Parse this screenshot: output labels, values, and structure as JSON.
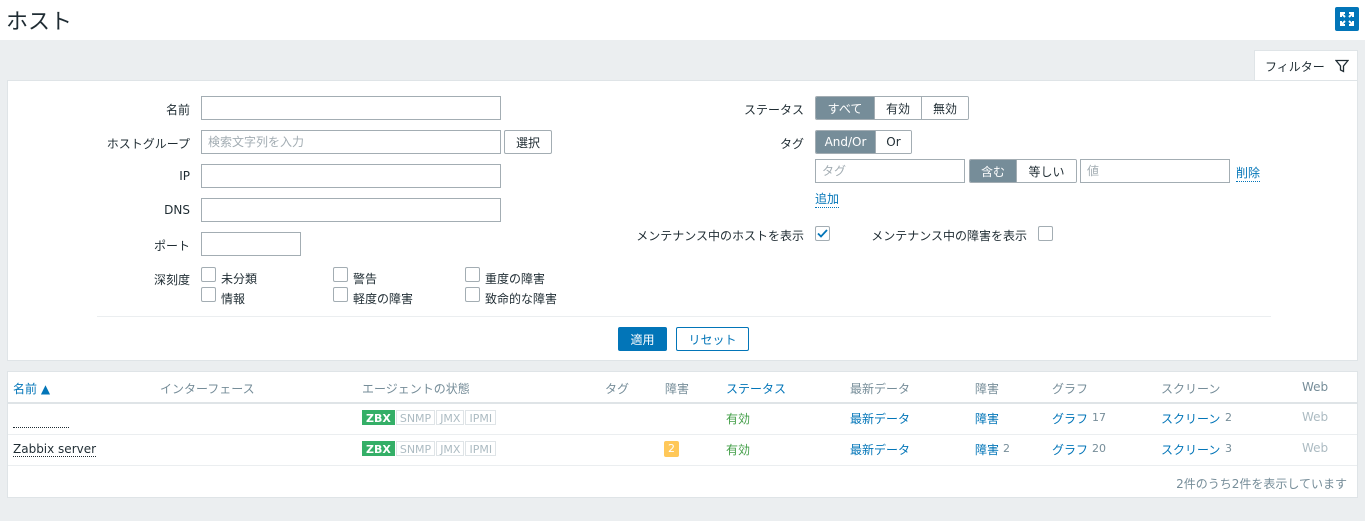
{
  "page": {
    "title": "ホスト"
  },
  "filter_tab": {
    "label": "フィルター"
  },
  "filter": {
    "name_label": "名前",
    "name_value": "",
    "hostgroup_label": "ホストグループ",
    "hostgroup_placeholder": "検索文字列を入力",
    "hostgroup_select": "選択",
    "ip_label": "IP",
    "ip_value": "",
    "dns_label": "DNS",
    "dns_value": "",
    "port_label": "ポート",
    "port_value": "",
    "severity_label": "深刻度",
    "severities": [
      {
        "label": "未分類",
        "checked": false
      },
      {
        "label": "情報",
        "checked": false
      },
      {
        "label": "警告",
        "checked": false
      },
      {
        "label": "軽度の障害",
        "checked": false
      },
      {
        "label": "重度の障害",
        "checked": false
      },
      {
        "label": "致命的な障害",
        "checked": false
      }
    ],
    "status_label": "ステータス",
    "status_options": [
      "すべて",
      "有効",
      "無効"
    ],
    "status_selected": "すべて",
    "tags_label": "タグ",
    "tags_logic": [
      "And/Or",
      "Or"
    ],
    "tags_logic_selected": "And/Or",
    "tag_placeholder": "タグ",
    "tag_ops": [
      "含む",
      "等しい"
    ],
    "tag_op_selected": "含む",
    "tag_value_placeholder": "値",
    "tag_remove": "削除",
    "tag_add": "追加",
    "maint_hosts_label": "メンテナンス中のホストを表示",
    "maint_hosts_checked": true,
    "maint_problems_label": "メンテナンス中の障害を表示",
    "maint_problems_checked": false,
    "apply": "適用",
    "reset": "リセット"
  },
  "table": {
    "columns": [
      "名前 ▲",
      "インターフェース",
      "エージェントの状態",
      "タグ",
      "障害",
      "ステータス",
      "最新データ",
      "障害",
      "グラフ",
      "スクリーン",
      "Web"
    ],
    "rows": [
      {
        "name": "",
        "availability": [
          "ZBX",
          "SNMP",
          "JMX",
          "IPMI"
        ],
        "problems": "",
        "status": "有効",
        "latest": "最新データ",
        "problems_link": "障害",
        "problems_count": "",
        "graphs": "グラフ",
        "graphs_count": "17",
        "screens": "スクリーン",
        "screens_count": "2",
        "web": "Web"
      },
      {
        "name": "Zabbix server",
        "availability": [
          "ZBX",
          "SNMP",
          "JMX",
          "IPMI"
        ],
        "problems": "2",
        "status": "有効",
        "latest": "最新データ",
        "problems_link": "障害",
        "problems_count": "2",
        "graphs": "グラフ",
        "graphs_count": "20",
        "screens": "スクリーン",
        "screens_count": "3",
        "web": "Web"
      }
    ],
    "footer": "2件のうち2件を表示しています"
  },
  "colors": {
    "accent": "#0275b8",
    "enabled": "#429e47",
    "zbx": "#34af67",
    "problem_badge": "#ffc859"
  }
}
